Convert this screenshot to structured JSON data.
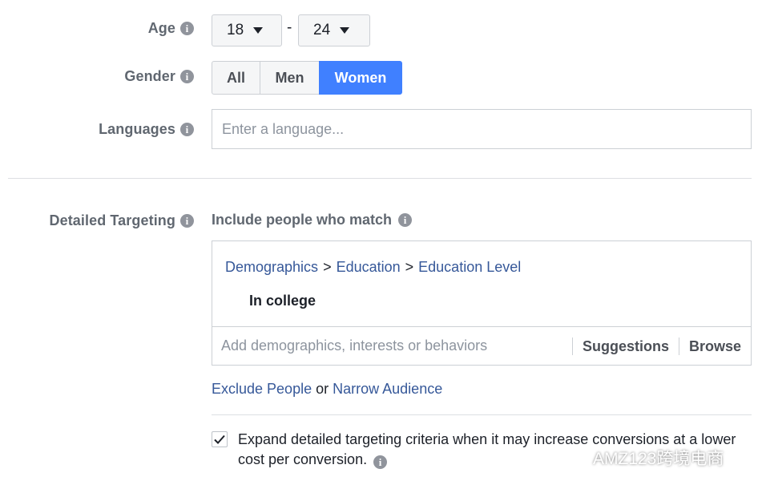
{
  "age": {
    "label": "Age",
    "min_value": "18",
    "max_value": "24",
    "separator": "-"
  },
  "gender": {
    "label": "Gender",
    "options": [
      "All",
      "Men",
      "Women"
    ],
    "selected": "Women"
  },
  "languages": {
    "label": "Languages",
    "placeholder": "Enter a language..."
  },
  "detailed_targeting": {
    "label": "Detailed Targeting",
    "include_label": "Include people who match",
    "breadcrumb": [
      "Demographics",
      "Education",
      "Education Level"
    ],
    "breadcrumb_separator": ">",
    "selected_item": "In college",
    "search_placeholder": "Add demographics, interests or behaviors",
    "suggestions_label": "Suggestions",
    "browse_label": "Browse"
  },
  "exclude_row": {
    "exclude_label": "Exclude People",
    "or_text": "or",
    "narrow_label": "Narrow Audience"
  },
  "expand": {
    "checked": true,
    "text": "Expand detailed targeting criteria when it may increase conversions at a lower cost per conversion."
  },
  "watermark": {
    "text": "AMZ123跨境电商"
  },
  "colors": {
    "accent": "#4080ff",
    "link": "#365899",
    "label": "#606770",
    "border": "#ccd0d5"
  },
  "icons": {
    "info": "info-icon",
    "caret": "caret-down-icon",
    "check": "checkmark-icon"
  }
}
